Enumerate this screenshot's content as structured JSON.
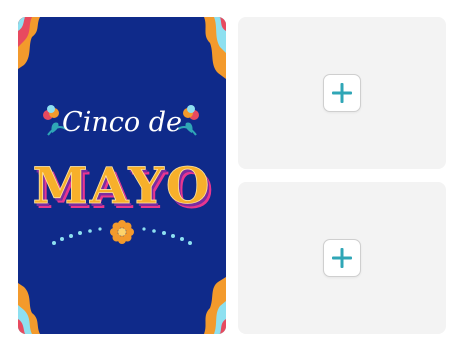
{
  "greeting_card": {
    "script_line": "Cinco de",
    "headline": "MAYO"
  },
  "slots": [
    {
      "action_icon": "plus-icon"
    },
    {
      "action_icon": "plus-icon"
    }
  ],
  "colors": {
    "card_background": "#0f2a8a",
    "accent_teal": "#2fa6b6",
    "letter_fill": "#f7b02b",
    "letter_shadow": "#e8368f",
    "slot_background": "#f3f3f3"
  }
}
